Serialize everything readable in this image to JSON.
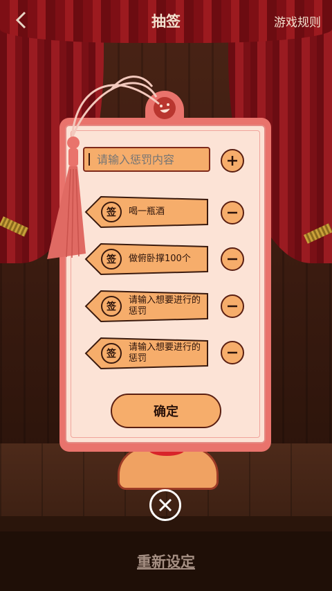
{
  "header": {
    "title": "抽签",
    "rules_label": "游戏规则",
    "back_icon": "chevron-left-icon"
  },
  "form": {
    "placeholder": "请输入惩罚内容",
    "value": "",
    "add_icon": "plus-circle-icon"
  },
  "lot_badge": "签",
  "lots": [
    {
      "text": "喝一瓶酒",
      "remove_icon": "minus-circle-icon"
    },
    {
      "text": "做俯卧撑100个",
      "remove_icon": "minus-circle-icon"
    },
    {
      "text": "请输入想要进行的惩罚",
      "remove_icon": "minus-circle-icon"
    },
    {
      "text": "请输入想要进行的惩罚",
      "remove_icon": "minus-circle-icon"
    }
  ],
  "confirm_label": "确定",
  "close_icon": "close-circle-icon",
  "reset_label": "重新设定",
  "colors": {
    "card": "#e9736c",
    "card_inner": "#fce3d6",
    "accent_orange": "#f6ad6b",
    "curtain_red": "#9a1b21"
  }
}
